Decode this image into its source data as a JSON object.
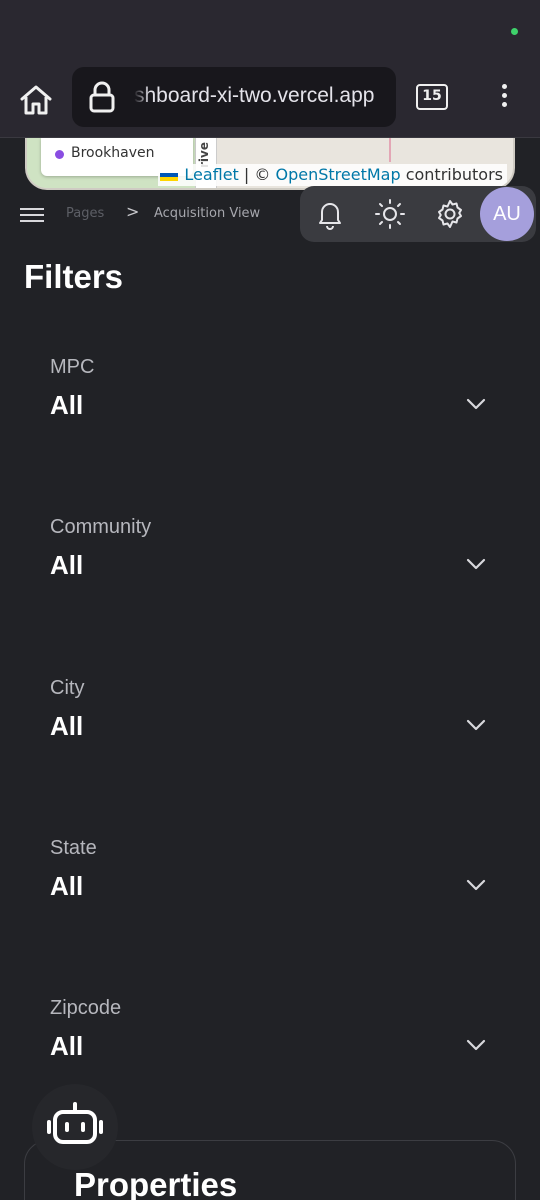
{
  "browser": {
    "url": "shboard-xi-two.vercel.app",
    "tab_count": "15"
  },
  "map": {
    "popup_label": "Brookhaven",
    "road_label": "rive",
    "attribution_leaflet": "Leaflet",
    "attribution_sep": " | © ",
    "attribution_osm": "OpenStreetMap",
    "attribution_suffix": " contributors"
  },
  "header": {
    "breadcrumb_root": "Pages",
    "breadcrumb_sep": ">",
    "breadcrumb_current": "Acquisition View",
    "avatar_initials": "AU"
  },
  "page": {
    "title": "Filters"
  },
  "filters": [
    {
      "label": "MPC",
      "value": "All"
    },
    {
      "label": "Community",
      "value": "All"
    },
    {
      "label": "City",
      "value": "All"
    },
    {
      "label": "State",
      "value": "All"
    },
    {
      "label": "Zipcode",
      "value": "All"
    }
  ],
  "properties": {
    "title": "Properties"
  },
  "icons": {
    "home": "home-icon",
    "lock": "lock-icon",
    "menu": "kebab-menu-icon",
    "hamburger": "hamburger-menu-icon",
    "bell": "bell-icon",
    "sun": "sun-icon",
    "gear": "gear-icon",
    "chevron": "chevron-down-icon",
    "bot": "robot-icon"
  },
  "colors": {
    "background": "#212226",
    "toolbar": "#3a3b40",
    "avatar": "#a59fdc",
    "link": "#0078a8"
  }
}
